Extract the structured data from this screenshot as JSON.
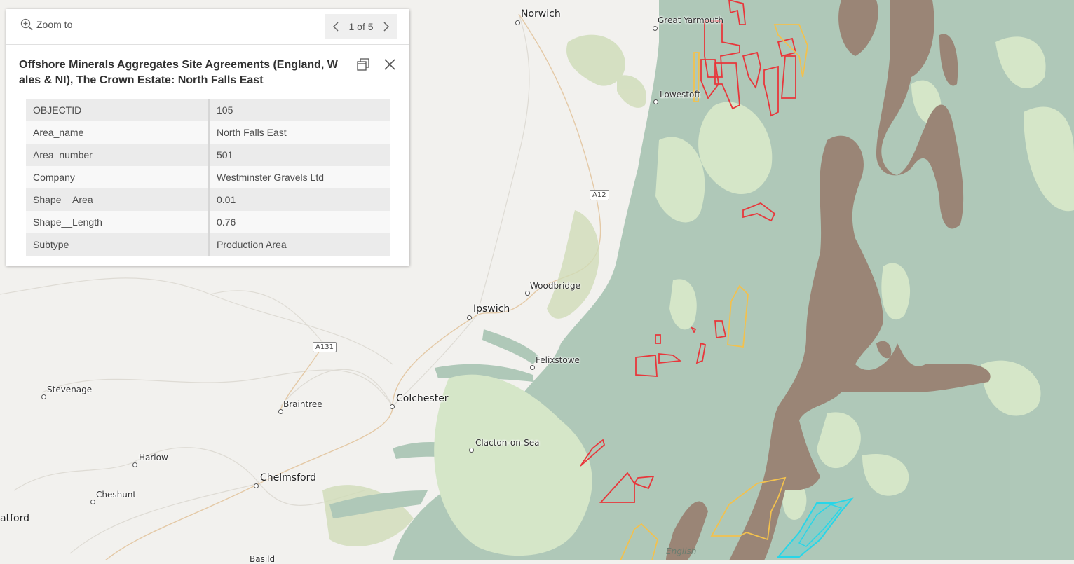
{
  "popup": {
    "zoom_label": "Zoom to",
    "pager_text": "1 of 5",
    "title": "Offshore Minerals Aggregates Site Agreements (England, Wales & NI), The Crown Estate: North Falls East",
    "attributes": [
      {
        "key": "OBJECTID",
        "value": "105"
      },
      {
        "key": "Area_name",
        "value": "North Falls East"
      },
      {
        "key": "Area_number",
        "value": "501"
      },
      {
        "key": "Company",
        "value": "Westminster Gravels Ltd"
      },
      {
        "key": "Shape__Area",
        "value": "0.01"
      },
      {
        "key": "Shape__Length",
        "value": "0.76"
      },
      {
        "key": "Subtype",
        "value": "Production Area"
      }
    ]
  },
  "map": {
    "places": {
      "norwich": "Norwich",
      "great_yarmouth": "Great Yarmouth",
      "lowestoft": "Lowestoft",
      "woodbridge": "Woodbridge",
      "ipswich": "Ipswich",
      "felixstowe": "Felixstowe",
      "stevenage": "Stevenage",
      "braintree": "Braintree",
      "colchester": "Colchester",
      "clacton": "Clacton-on-Sea",
      "harlow": "Harlow",
      "chelmsford": "Chelmsford",
      "cheshunt": "Cheshunt",
      "watford_partial": "atford",
      "basildon_partial": "Basild"
    },
    "roads": {
      "a12": "A12",
      "a131": "A131"
    },
    "sea_label": "English",
    "colors": {
      "land": "#f2f1ee",
      "sea": "#afc8b8",
      "sand_light": "#d5e6c8",
      "gravel": "#9a8576",
      "production_area": "#e8373b",
      "option_area": "#f2c14e",
      "highlight": "#27d6e8"
    }
  }
}
